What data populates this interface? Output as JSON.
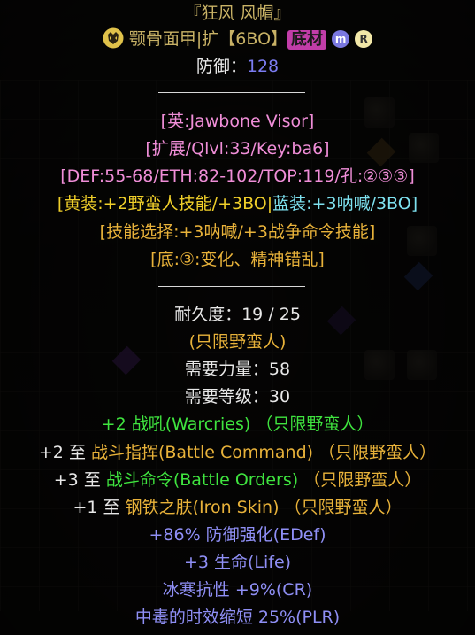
{
  "item": {
    "name": "『狂风 风帽』",
    "base_line_prefix": "颚骨面甲|扩【6BO】",
    "base_badge": "底材",
    "badge_m": "m",
    "badge_r": "R",
    "defense_label": "防御：",
    "defense_value": "128",
    "en_name": "[英:Jawbone Visor]",
    "ext_info": "[扩展/Qlvl:33/Key:ba6]",
    "stats_range": "[DEF:55-68/ETH:82-102/TOP:119/孔:②③③]",
    "yellow_mod_text": "[黄装:+2野蛮人技能/+3BO|",
    "blue_mod_text": "蓝装:+3呐喊/3BO]",
    "skill_choice": "[技能选择:+3呐喊/+3战争命令技能]",
    "base_mod": "[底:③:变化、精神错乱]",
    "durability_label": "耐久度：",
    "durability_value": "19 / 25",
    "class_only": "(只限野蛮人)",
    "req_str_label": "需要力量：",
    "req_str_value": "58",
    "req_lvl_label": "需要等级：",
    "req_lvl_value": "30",
    "mod1": "+2 战吼(Warcries) （只限野蛮人）",
    "mod2_prefix": "+2 至 ",
    "mod2_skill": "战斗指挥(Battle Command)",
    "mod2_suffix": " （只限野蛮人）",
    "mod3_prefix": "+3 至 ",
    "mod3_skill": "战斗命令(Battle Orders)",
    "mod3_suffix": " （只限野蛮人）",
    "mod4_prefix": "+1 至 ",
    "mod4_skill": "钢铁之肤(Iron Skin)",
    "mod4_suffix": " （只限野蛮人）",
    "mod5": "+86% 防御强化(EDef)",
    "mod6": "+3 生命(Life)",
    "mod7": "冰寒抗性 +9%(CR)",
    "mod8": "中毒的时效缩短 25%(PLR)"
  },
  "icons": {
    "class_icon": "barbarian-helm-icon"
  },
  "colors": {
    "unique_gold": "#c8b266",
    "magic_blue": "#7b7cf2",
    "set_green": "#3fe43f",
    "base_badge": "#c13da8"
  }
}
